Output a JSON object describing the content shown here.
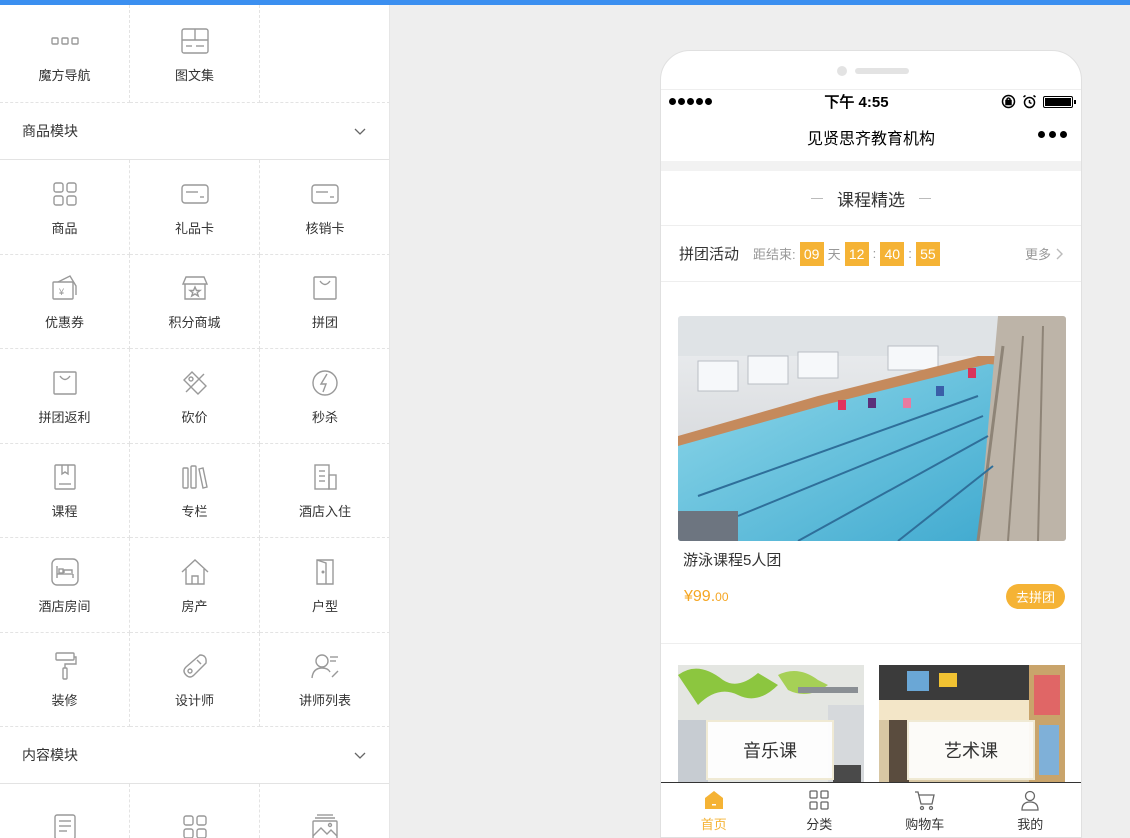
{
  "left_panel": {
    "top_row": [
      {
        "label": "魔方导航",
        "icon": "cube-nav-icon"
      },
      {
        "label": "图文集",
        "icon": "image-text-icon"
      }
    ],
    "goods_section": {
      "title": "商品模块",
      "items": [
        {
          "label": "商品",
          "icon": "goods-grid-icon"
        },
        {
          "label": "礼品卡",
          "icon": "gift-card-icon"
        },
        {
          "label": "核销卡",
          "icon": "verify-card-icon"
        },
        {
          "label": "优惠券",
          "icon": "coupon-icon"
        },
        {
          "label": "积分商城",
          "icon": "points-mall-icon"
        },
        {
          "label": "拼团",
          "icon": "group-buy-icon"
        },
        {
          "label": "拼团返利",
          "icon": "group-rebate-icon"
        },
        {
          "label": "砍价",
          "icon": "bargain-icon"
        },
        {
          "label": "秒杀",
          "icon": "flash-sale-icon"
        },
        {
          "label": "课程",
          "icon": "course-icon"
        },
        {
          "label": "专栏",
          "icon": "column-icon"
        },
        {
          "label": "酒店入住",
          "icon": "hotel-checkin-icon"
        },
        {
          "label": "酒店房间",
          "icon": "hotel-room-icon"
        },
        {
          "label": "房产",
          "icon": "house-icon"
        },
        {
          "label": "户型",
          "icon": "floor-plan-icon"
        },
        {
          "label": "装修",
          "icon": "paint-roller-icon"
        },
        {
          "label": "设计师",
          "icon": "designer-icon"
        },
        {
          "label": "讲师列表",
          "icon": "lecturer-list-icon"
        }
      ]
    },
    "content_section": {
      "title": "内容模块",
      "items": [
        {
          "icon": "article-icon"
        },
        {
          "icon": "content-grid-icon"
        },
        {
          "icon": "gallery-icon"
        }
      ]
    }
  },
  "phone": {
    "status": {
      "time": "下午 4:55"
    },
    "nav_title": "见贤思齐教育机构",
    "section_title": "课程精选",
    "group_buy": {
      "title": "拼团活动",
      "countdown_label": "距结束:",
      "days": "09",
      "day_unit": "天",
      "hours": "12",
      "minutes": "40",
      "seconds": "55",
      "sep": ":",
      "more": "更多"
    },
    "product": {
      "name": "游泳课程5人团",
      "price_main": "¥99.",
      "price_decimal": "00",
      "button": "去拼团"
    },
    "categories": [
      {
        "label": "音乐课"
      },
      {
        "label": "艺术课"
      }
    ],
    "tabs": [
      {
        "label": "首页",
        "icon": "home-icon"
      },
      {
        "label": "分类",
        "icon": "category-icon"
      },
      {
        "label": "购物车",
        "icon": "cart-icon"
      },
      {
        "label": "我的",
        "icon": "user-icon"
      }
    ]
  },
  "colors": {
    "accent": "#f5b335",
    "price": "#f5a623",
    "topbar": "#3b8ff0"
  }
}
